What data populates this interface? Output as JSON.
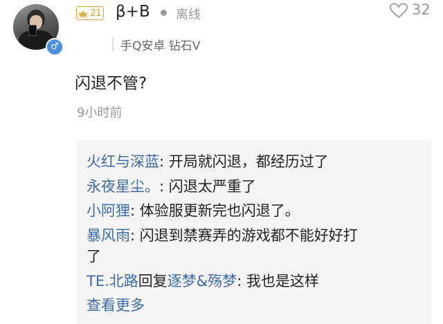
{
  "user": {
    "name": "β+B",
    "level": "21",
    "status": "离线",
    "device": "手Q安卓 钻石V",
    "gender_symbol": "♂"
  },
  "likes": {
    "count": "32"
  },
  "post": {
    "content": "闪退不管?",
    "time": "9小时前"
  },
  "replies": [
    {
      "name": "火红与深蓝",
      "text": ": 开局就闪退，都经历过了"
    },
    {
      "name": "永夜星尘。",
      "text": ": 闪退太严重了"
    },
    {
      "name": "小阿狸",
      "text": ": 体验服更新完也闪退了。"
    },
    {
      "name": "暴风雨",
      "text": ": 闪退到禁赛弄的游戏都不能好好打",
      "text_cont": "了"
    },
    {
      "name": "TE.北路",
      "reply_word": "回复",
      "target": "逐梦&殇梦",
      "text": ": 我也是这样"
    }
  ],
  "more_label": "查看更多",
  "colors": {
    "name_link": "#3c6aa8",
    "level_badge": "#e0a83a",
    "gender_badge": "#4a90e2",
    "muted_text": "#999999",
    "reply_bg": "#f4f4f4"
  },
  "icons": [
    "crown-icon",
    "heart-icon",
    "male-icon"
  ]
}
